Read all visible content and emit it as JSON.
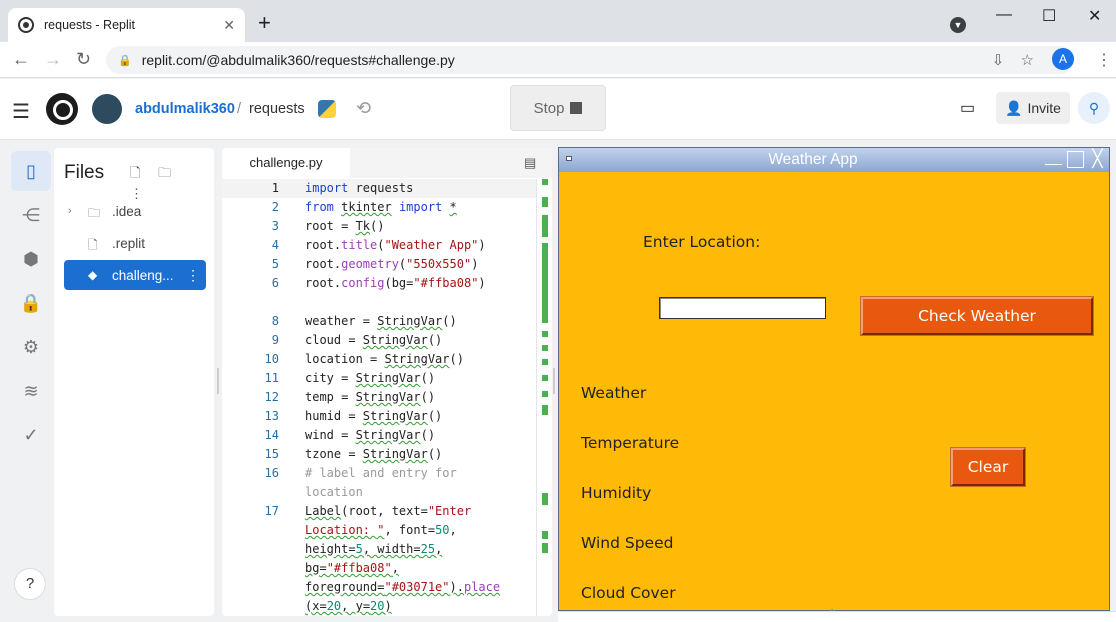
{
  "browser": {
    "tab_title": "requests - Replit",
    "tab_close": "✕",
    "new_tab": "+",
    "url": "replit.com/@abdulmalik360/requests#challenge.py",
    "profile_initial": "A"
  },
  "replit": {
    "username": "abdulmalik360",
    "separator": "/",
    "repl_name": "requests",
    "stop_label": "Stop",
    "invite_label": "Invite"
  },
  "files_panel": {
    "title": "Files",
    "items": [
      {
        "label": ".idea",
        "type": "folder"
      },
      {
        "label": ".replit",
        "type": "file"
      },
      {
        "label": "challeng...",
        "type": "python",
        "selected": true
      }
    ]
  },
  "help_label": "?",
  "editor": {
    "tab_label": "challenge.py",
    "line_numbers": [
      "1",
      "2",
      "3",
      "4",
      "5",
      "6",
      "",
      "8",
      "9",
      "10",
      "11",
      "12",
      "13",
      "14",
      "15",
      "16",
      "",
      "17"
    ]
  },
  "tk_window": {
    "title": "Weather App",
    "enter_location_label": "Enter Location:",
    "location_value": "",
    "check_button": "Check Weather",
    "clear_button": "Clear",
    "labels": [
      "Weather",
      "Temperature",
      "Humidity",
      "Wind Speed",
      "Cloud Cover"
    ]
  },
  "colors": {
    "tk_bg": "#ffba08",
    "tk_button": "#e8580e",
    "replit_blue": "#1b6fd1"
  }
}
